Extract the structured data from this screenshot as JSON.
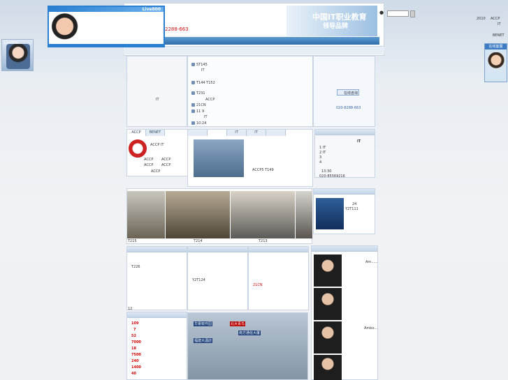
{
  "chat_popup": {
    "brand": "Live800"
  },
  "left_chat": {
    "label": "Live800"
  },
  "header": {
    "phone": "2288-663",
    "banner_line1": "中国IT职业教育",
    "banner_line2": "领导品牌",
    "search_dot": "●"
  },
  "right_top": {
    "lines": [
      "2010",
      "ACCP",
      "IT",
      "BENET"
    ]
  },
  "right_widget": {
    "title": "在线客服"
  },
  "col_mid_top": {
    "items": [
      "ST145",
      "IT",
      "T144  T152",
      "T231",
      "ACCP",
      "21CN",
      "11 9",
      "IT",
      "10:24"
    ]
  },
  "col_left_top": {
    "items": [
      "IT"
    ]
  },
  "col_right_top": {
    "contact_button": "在线咨询",
    "phone": "020-8288-663"
  },
  "left_tabs": {
    "tabs": [
      "ACCP",
      "BENET"
    ],
    "body": [
      "ACCP  IT",
      "ACCP",
      "ACCP",
      "ACCP",
      "ACCP",
      "ACCP"
    ]
  },
  "mid_tabs": {
    "tabs": [
      "IT",
      "IT"
    ],
    "caption": "ACCP5 T149"
  },
  "right_info": {
    "title": "IT",
    "lines": [
      "1 IT",
      "2      IT",
      "3",
      "4",
      "13:30",
      "020-85569216"
    ]
  },
  "photo_strip": {
    "captions": [
      "T215",
      "T214",
      "T213"
    ]
  },
  "right_small": {
    "lines": [
      "24",
      "Y2T111"
    ]
  },
  "lists": {
    "col1": [
      "T226",
      "Y2T124"
    ],
    "col2": [
      "Y2T124"
    ],
    "col3": [
      "21CN"
    ]
  },
  "people": {
    "names": [
      "Am......",
      "Ambo..."
    ]
  },
  "prices": {
    "values": [
      "109",
      "7",
      "52",
      "7000",
      "18",
      "7500",
      "240",
      "1400",
      "40"
    ]
  },
  "map": {
    "labels": [
      "华景软件园",
      "北大青鸟",
      "南方通信大厦",
      "福建大酒店"
    ]
  }
}
